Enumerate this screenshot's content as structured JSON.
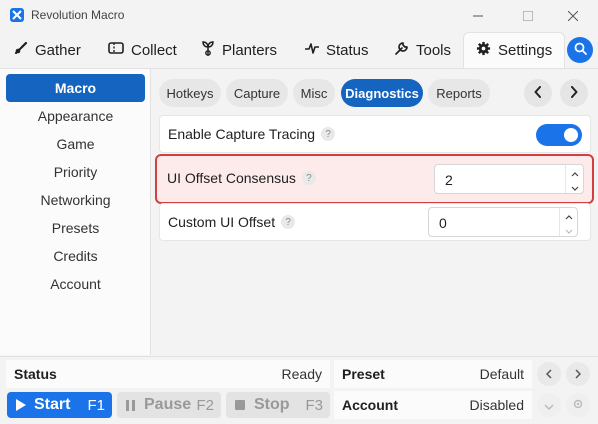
{
  "app": {
    "title": "Revolution Macro",
    "icon": "app-logo-icon",
    "accent_color": "#1a73e8"
  },
  "main_tabs": [
    {
      "label": "Gather",
      "icon": "brush-icon"
    },
    {
      "label": "Collect",
      "icon": "ticket-icon"
    },
    {
      "label": "Planters",
      "icon": "plant-icon"
    },
    {
      "label": "Status",
      "icon": "pulse-icon"
    },
    {
      "label": "Tools",
      "icon": "wrench-icon"
    },
    {
      "label": "Settings",
      "icon": "gear-icon",
      "active": true
    }
  ],
  "sidebar": {
    "items": [
      {
        "label": "Macro",
        "active": true
      },
      {
        "label": "Appearance"
      },
      {
        "label": "Game"
      },
      {
        "label": "Priority"
      },
      {
        "label": "Networking"
      },
      {
        "label": "Presets"
      },
      {
        "label": "Credits"
      },
      {
        "label": "Account"
      }
    ]
  },
  "sub_tabs": [
    {
      "label": "Hotkeys"
    },
    {
      "label": "Capture"
    },
    {
      "label": "Misc"
    },
    {
      "label": "Diagnostics",
      "active": true
    },
    {
      "label": "Reports"
    }
  ],
  "settings": {
    "capture_tracing": {
      "label": "Enable Capture Tracing",
      "help": "?",
      "enabled": true
    },
    "ui_offset_consensus": {
      "label": "UI Offset Consensus",
      "help": "?",
      "value": "2"
    },
    "custom_ui_offset": {
      "label": "Custom UI Offset",
      "help": "?",
      "value": "0"
    }
  },
  "bottom": {
    "status_label": "Status",
    "status_value": "Ready",
    "preset_label": "Preset",
    "preset_value": "Default",
    "account_label": "Account",
    "account_value": "Disabled",
    "start": {
      "label": "Start",
      "key": "F1"
    },
    "pause": {
      "label": "Pause",
      "key": "F2"
    },
    "stop": {
      "label": "Stop",
      "key": "F3"
    }
  }
}
